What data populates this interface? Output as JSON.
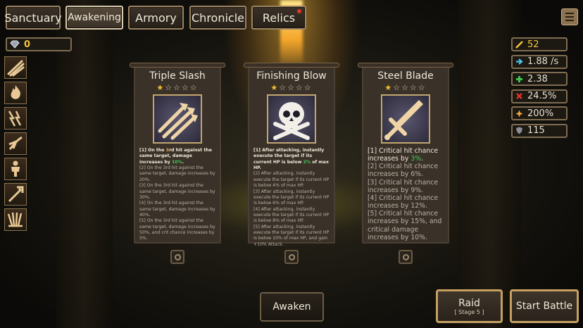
{
  "tabs": [
    {
      "label": "Sanctuary",
      "active": false
    },
    {
      "label": "Awakening",
      "active": true
    },
    {
      "label": "Armory",
      "active": false
    },
    {
      "label": "Chronicle",
      "active": false
    },
    {
      "label": "Relics",
      "active": false,
      "notification": true
    }
  ],
  "currency": {
    "value": "0"
  },
  "skills_sidebar": [
    "slash-skill-icon",
    "flame-skill-icon",
    "lightning-skill-icon",
    "claw-skill-icon",
    "body-skill-icon",
    "trident-skill-icon",
    "burst-skill-icon"
  ],
  "stats": [
    {
      "icon": "attack-icon",
      "value": "52",
      "color": "#f4c542"
    },
    {
      "icon": "speed-icon",
      "value": "1.88 /s",
      "color": "#e9e2d2"
    },
    {
      "icon": "heal-icon",
      "value": "2.38",
      "color": "#e9e2d2"
    },
    {
      "icon": "crit-chance-icon",
      "value": "24.5%",
      "color": "#e9e2d2"
    },
    {
      "icon": "crit-damage-icon",
      "value": "200%",
      "color": "#e9e2d2"
    },
    {
      "icon": "defense-icon",
      "value": "115",
      "color": "#e9e2d2"
    }
  ],
  "cards": [
    {
      "title": "Triple Slash",
      "stars": 1,
      "max_stars": 5,
      "icon": "triple-arrows-icon",
      "lines": [
        {
          "pre": "[1] On the ",
          "hl": "3",
          "mid": "rd hit against the same target, damage increases by ",
          "hl2": "10%",
          "post": "."
        },
        "[2] On the 3rd hit against the same target, damage increases by 20%.",
        "[3] On the 3rd hit against the same target, damage increases by 30%.",
        "[4] On the 3rd hit against the same target, damage increases by 40%.",
        "[5] On the 3rd hit against the same target, damage increases by 50%, and crit chance increases by 5%."
      ]
    },
    {
      "title": "Finishing Blow",
      "stars": 1,
      "max_stars": 5,
      "icon": "skull-crossbones-icon",
      "lines": [
        {
          "pre": "[1] After attacking, instantly execute the target if its current HP is below ",
          "hl2": "2%",
          "post": " of max HP."
        },
        "[2] After attacking, instantly execute the target if its current HP is below 4% of max HP.",
        "[3] After attacking, instantly execute the target if its current HP is below 6% of max HP.",
        "[4] After attacking, instantly execute the target if its current HP is below 8% of max HP.",
        "[5] After attacking, instantly execute the target if its current HP is below 10% of max HP, and gain +10% Attack."
      ]
    },
    {
      "title": "Steel Blade",
      "stars": 1,
      "max_stars": 5,
      "icon": "sword-icon",
      "lines": [
        {
          "pre": "[1] Critical hit chance increases by ",
          "hl2": "3%",
          "post": "."
        },
        "[2] Critical hit chance increases by 6%.",
        "[3] Critical hit chance increases by 9%.",
        "[4] Critical hit chance increases by 12%.",
        "[5] Critical hit chance increases by 15%, and critical damage increases by 10%."
      ]
    }
  ],
  "buttons": {
    "awaken": "Awaken",
    "raid": "Raid",
    "raid_stage": "[ Stage 5 ]",
    "start_battle": "Start Battle"
  }
}
